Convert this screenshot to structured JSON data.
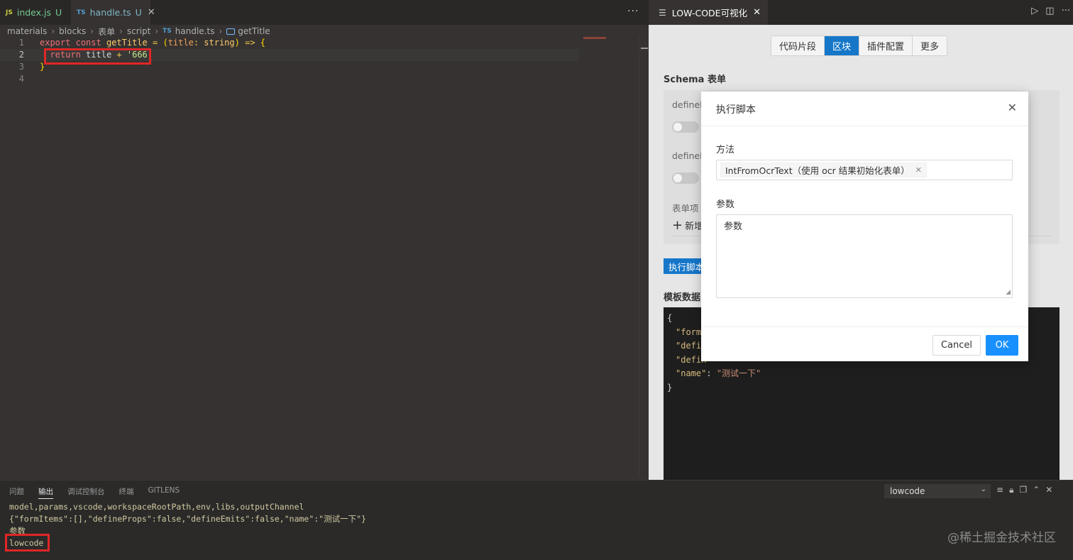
{
  "editor": {
    "tabs": [
      {
        "type": "JS",
        "name": "index.js",
        "status": "U"
      },
      {
        "type": "TS",
        "name": "handle.ts",
        "status": "U"
      }
    ],
    "more_icon": "···",
    "breadcrumb": [
      "materials",
      "blocks",
      "表单",
      "script",
      "handle.ts",
      "getTitle"
    ],
    "breadcrumb_ts": "TS",
    "line_numbers": [
      "1",
      "2",
      "3",
      "4"
    ],
    "code": {
      "l1": {
        "export": "export",
        "const": "const",
        "name": "getTitle",
        "eq": "=",
        "lp": "(",
        "param": "title",
        "colon": ":",
        "type": "string",
        "rp": ")",
        "arrow": "=>",
        "brace": "{"
      },
      "l2": {
        "return": "return",
        "var": "title",
        "plus": "+",
        "str": "'666'"
      },
      "l3": {
        "brace": "}"
      }
    }
  },
  "panel": {
    "tab_title": "LOW-CODE可视化",
    "segments": [
      "代码片段",
      "区块",
      "插件配置",
      "更多"
    ],
    "active_segment": "区块",
    "schema_title": "Schema 表单",
    "fields": {
      "define_props": "defineP",
      "define_emits": "defineE",
      "form_items": "表单项"
    },
    "add_label": "新增",
    "exec_button": "执行脚本",
    "template_title": "模板数据",
    "template_code": {
      "open": "{",
      "k1": "\"formI",
      "k2": "\"defin",
      "k3": "\"defin",
      "k4": "\"name\"",
      "colon": ": ",
      "v4": "\"测试一下\"",
      "close": "}"
    }
  },
  "modal": {
    "title": "执行脚本",
    "method_label": "方法",
    "method_value": "IntFromOcrText（使用 ocr 结果初始化表单）",
    "params_label": "参数",
    "params_value": "参数",
    "cancel": "Cancel",
    "ok": "OK"
  },
  "bottom": {
    "tabs": [
      "问题",
      "输出",
      "调试控制台",
      "终端",
      "GITLENS"
    ],
    "active_tab": "输出",
    "channel": "lowcode",
    "output_lines": [
      "model,params,vscode,workspaceRootPath,env,libs,outputChannel",
      "{\"formItems\":[],\"defineProps\":false,\"defineEmits\":false,\"name\":\"测试一下\"}",
      "参数",
      "lowcode"
    ],
    "watermark": "@稀土掘金技术社区"
  }
}
